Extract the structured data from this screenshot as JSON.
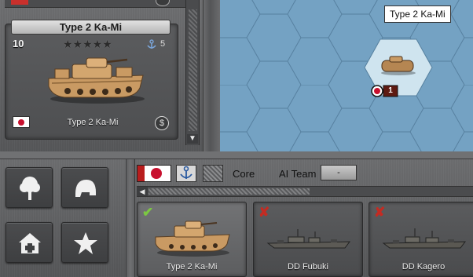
{
  "left_panel": {
    "card": {
      "name": "Type 2 Ka-Mi",
      "level": "10",
      "stars": "★★★★★",
      "strength": "5",
      "label": "Type 2 Ka-Mi",
      "cost_icon": "$",
      "flag": "japan-flag-icon",
      "image": "amphibious-tank-sprite"
    },
    "scroll_down": "▼"
  },
  "map": {
    "tooltip": "Type 2 Ka-Mi",
    "unit_strength": "1",
    "colors": {
      "water": "#74a2c3",
      "highlight": "#cfe4ef",
      "hex_line": "#56809f"
    }
  },
  "bottom": {
    "command_buttons": [
      {
        "name": "tree-icon"
      },
      {
        "name": "helmet-icon"
      },
      {
        "name": "house-plus-icon"
      },
      {
        "name": "star-icon"
      }
    ],
    "toolbar": {
      "core_label": "Core",
      "ai_team_label": "AI Team",
      "ai_team_value": "-",
      "scroll_left": "◀"
    },
    "units": [
      {
        "label": "Type 2 Ka-Mi",
        "status": "✔",
        "status_name": "check-icon",
        "selected": true
      },
      {
        "label": "DD Fubuki",
        "status": "✘",
        "status_name": "cross-icon",
        "selected": false
      },
      {
        "label": "DD Kagero",
        "status": "✘",
        "status_name": "cross-icon",
        "selected": false
      }
    ]
  }
}
